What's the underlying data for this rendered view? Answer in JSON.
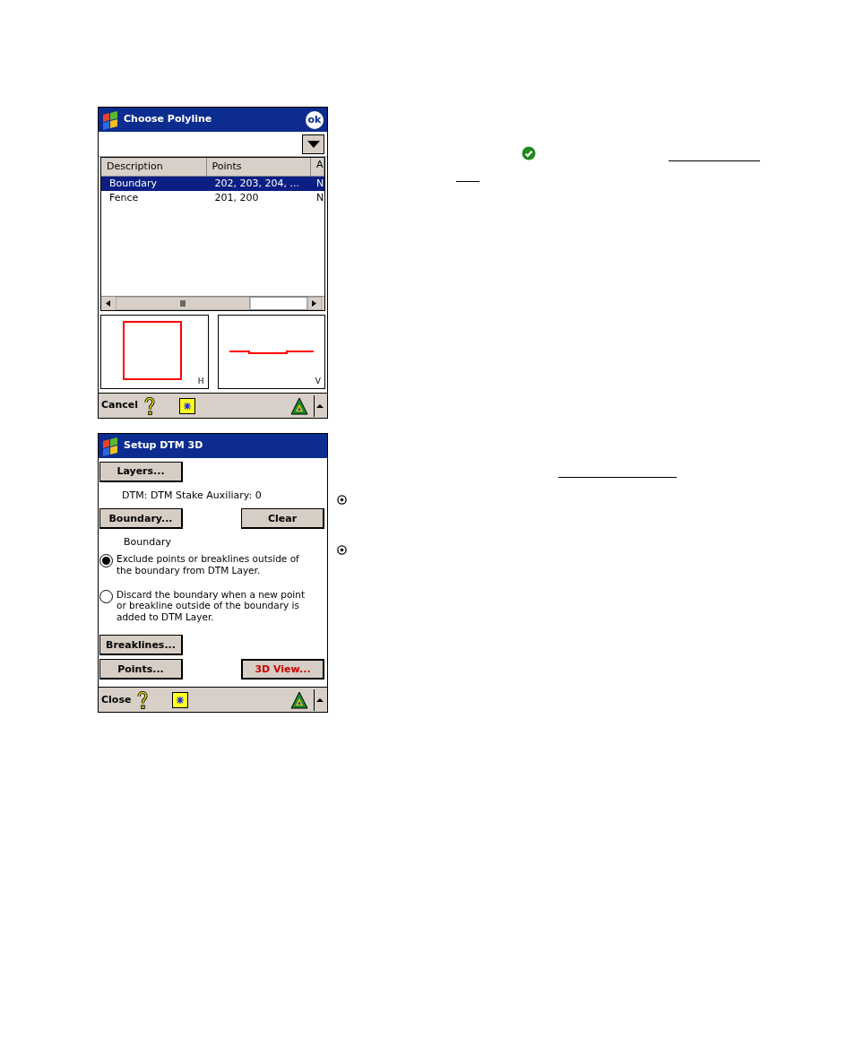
{
  "choose_polyline": {
    "title": "Choose Polyline",
    "ok_label": "ok",
    "columns": [
      "Description",
      "Points",
      "A"
    ],
    "rows": [
      {
        "cells": [
          "Boundary",
          "202, 203, 204, ...",
          "N"
        ],
        "selected": true
      },
      {
        "cells": [
          "Fence",
          "201, 200",
          "N"
        ],
        "selected": false
      }
    ],
    "previews": [
      {
        "kind": "plan",
        "label": "H"
      },
      {
        "kind": "profile",
        "label": "V"
      }
    ],
    "command": "Cancel"
  },
  "setup_dtm": {
    "title": "Setup DTM 3D",
    "items": [
      {
        "kind": "buttons",
        "buttons": [
          {
            "label": "Layers...",
            "default": false
          }
        ]
      },
      {
        "kind": "text",
        "text": "DTM: DTM Stake Auxiliary: 0"
      },
      {
        "kind": "buttons",
        "buttons": [
          {
            "label": "Boundary...",
            "default": false
          },
          {
            "label": "Clear",
            "default": false
          }
        ]
      },
      {
        "kind": "text",
        "text": "Boundary"
      },
      {
        "kind": "radio",
        "text": "Exclude points or breaklines outside of the boundary from DTM Layer.",
        "selected": true
      },
      {
        "kind": "radio",
        "text": "Discard the boundary when a new point or breakline outside of the boundary is added to DTM Layer.",
        "selected": false
      },
      {
        "kind": "buttons",
        "buttons": [
          {
            "label": "Breaklines...",
            "default": false
          }
        ]
      },
      {
        "kind": "buttons",
        "buttons": [
          {
            "label": "Points...",
            "default": false
          },
          {
            "label": "3D View...",
            "default": true
          }
        ]
      }
    ],
    "command": "Close"
  }
}
